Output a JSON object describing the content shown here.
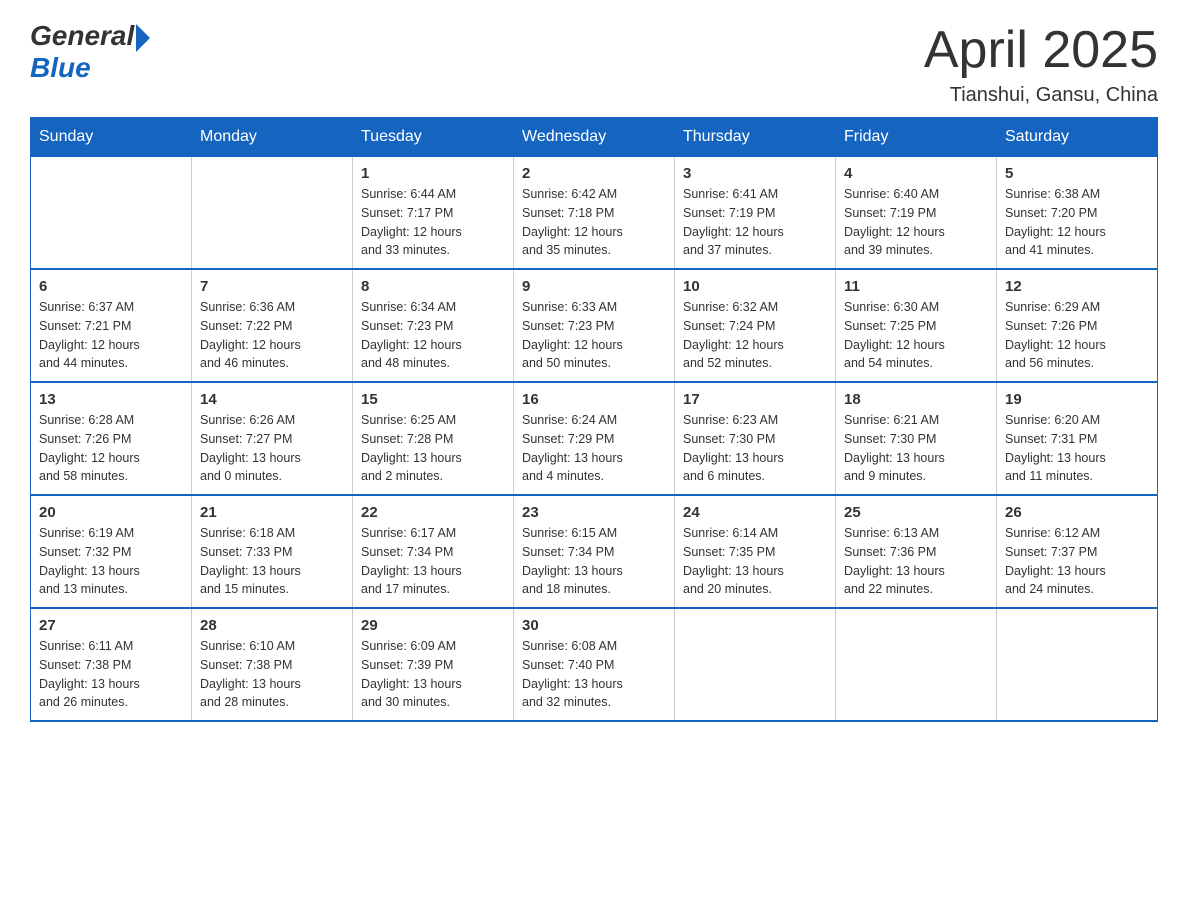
{
  "logo": {
    "general": "General",
    "blue": "Blue"
  },
  "title": "April 2025",
  "subtitle": "Tianshui, Gansu, China",
  "days_of_week": [
    "Sunday",
    "Monday",
    "Tuesday",
    "Wednesday",
    "Thursday",
    "Friday",
    "Saturday"
  ],
  "weeks": [
    [
      {
        "day": "",
        "info": ""
      },
      {
        "day": "",
        "info": ""
      },
      {
        "day": "1",
        "info": "Sunrise: 6:44 AM\nSunset: 7:17 PM\nDaylight: 12 hours\nand 33 minutes."
      },
      {
        "day": "2",
        "info": "Sunrise: 6:42 AM\nSunset: 7:18 PM\nDaylight: 12 hours\nand 35 minutes."
      },
      {
        "day": "3",
        "info": "Sunrise: 6:41 AM\nSunset: 7:19 PM\nDaylight: 12 hours\nand 37 minutes."
      },
      {
        "day": "4",
        "info": "Sunrise: 6:40 AM\nSunset: 7:19 PM\nDaylight: 12 hours\nand 39 minutes."
      },
      {
        "day": "5",
        "info": "Sunrise: 6:38 AM\nSunset: 7:20 PM\nDaylight: 12 hours\nand 41 minutes."
      }
    ],
    [
      {
        "day": "6",
        "info": "Sunrise: 6:37 AM\nSunset: 7:21 PM\nDaylight: 12 hours\nand 44 minutes."
      },
      {
        "day": "7",
        "info": "Sunrise: 6:36 AM\nSunset: 7:22 PM\nDaylight: 12 hours\nand 46 minutes."
      },
      {
        "day": "8",
        "info": "Sunrise: 6:34 AM\nSunset: 7:23 PM\nDaylight: 12 hours\nand 48 minutes."
      },
      {
        "day": "9",
        "info": "Sunrise: 6:33 AM\nSunset: 7:23 PM\nDaylight: 12 hours\nand 50 minutes."
      },
      {
        "day": "10",
        "info": "Sunrise: 6:32 AM\nSunset: 7:24 PM\nDaylight: 12 hours\nand 52 minutes."
      },
      {
        "day": "11",
        "info": "Sunrise: 6:30 AM\nSunset: 7:25 PM\nDaylight: 12 hours\nand 54 minutes."
      },
      {
        "day": "12",
        "info": "Sunrise: 6:29 AM\nSunset: 7:26 PM\nDaylight: 12 hours\nand 56 minutes."
      }
    ],
    [
      {
        "day": "13",
        "info": "Sunrise: 6:28 AM\nSunset: 7:26 PM\nDaylight: 12 hours\nand 58 minutes."
      },
      {
        "day": "14",
        "info": "Sunrise: 6:26 AM\nSunset: 7:27 PM\nDaylight: 13 hours\nand 0 minutes."
      },
      {
        "day": "15",
        "info": "Sunrise: 6:25 AM\nSunset: 7:28 PM\nDaylight: 13 hours\nand 2 minutes."
      },
      {
        "day": "16",
        "info": "Sunrise: 6:24 AM\nSunset: 7:29 PM\nDaylight: 13 hours\nand 4 minutes."
      },
      {
        "day": "17",
        "info": "Sunrise: 6:23 AM\nSunset: 7:30 PM\nDaylight: 13 hours\nand 6 minutes."
      },
      {
        "day": "18",
        "info": "Sunrise: 6:21 AM\nSunset: 7:30 PM\nDaylight: 13 hours\nand 9 minutes."
      },
      {
        "day": "19",
        "info": "Sunrise: 6:20 AM\nSunset: 7:31 PM\nDaylight: 13 hours\nand 11 minutes."
      }
    ],
    [
      {
        "day": "20",
        "info": "Sunrise: 6:19 AM\nSunset: 7:32 PM\nDaylight: 13 hours\nand 13 minutes."
      },
      {
        "day": "21",
        "info": "Sunrise: 6:18 AM\nSunset: 7:33 PM\nDaylight: 13 hours\nand 15 minutes."
      },
      {
        "day": "22",
        "info": "Sunrise: 6:17 AM\nSunset: 7:34 PM\nDaylight: 13 hours\nand 17 minutes."
      },
      {
        "day": "23",
        "info": "Sunrise: 6:15 AM\nSunset: 7:34 PM\nDaylight: 13 hours\nand 18 minutes."
      },
      {
        "day": "24",
        "info": "Sunrise: 6:14 AM\nSunset: 7:35 PM\nDaylight: 13 hours\nand 20 minutes."
      },
      {
        "day": "25",
        "info": "Sunrise: 6:13 AM\nSunset: 7:36 PM\nDaylight: 13 hours\nand 22 minutes."
      },
      {
        "day": "26",
        "info": "Sunrise: 6:12 AM\nSunset: 7:37 PM\nDaylight: 13 hours\nand 24 minutes."
      }
    ],
    [
      {
        "day": "27",
        "info": "Sunrise: 6:11 AM\nSunset: 7:38 PM\nDaylight: 13 hours\nand 26 minutes."
      },
      {
        "day": "28",
        "info": "Sunrise: 6:10 AM\nSunset: 7:38 PM\nDaylight: 13 hours\nand 28 minutes."
      },
      {
        "day": "29",
        "info": "Sunrise: 6:09 AM\nSunset: 7:39 PM\nDaylight: 13 hours\nand 30 minutes."
      },
      {
        "day": "30",
        "info": "Sunrise: 6:08 AM\nSunset: 7:40 PM\nDaylight: 13 hours\nand 32 minutes."
      },
      {
        "day": "",
        "info": ""
      },
      {
        "day": "",
        "info": ""
      },
      {
        "day": "",
        "info": ""
      }
    ]
  ]
}
